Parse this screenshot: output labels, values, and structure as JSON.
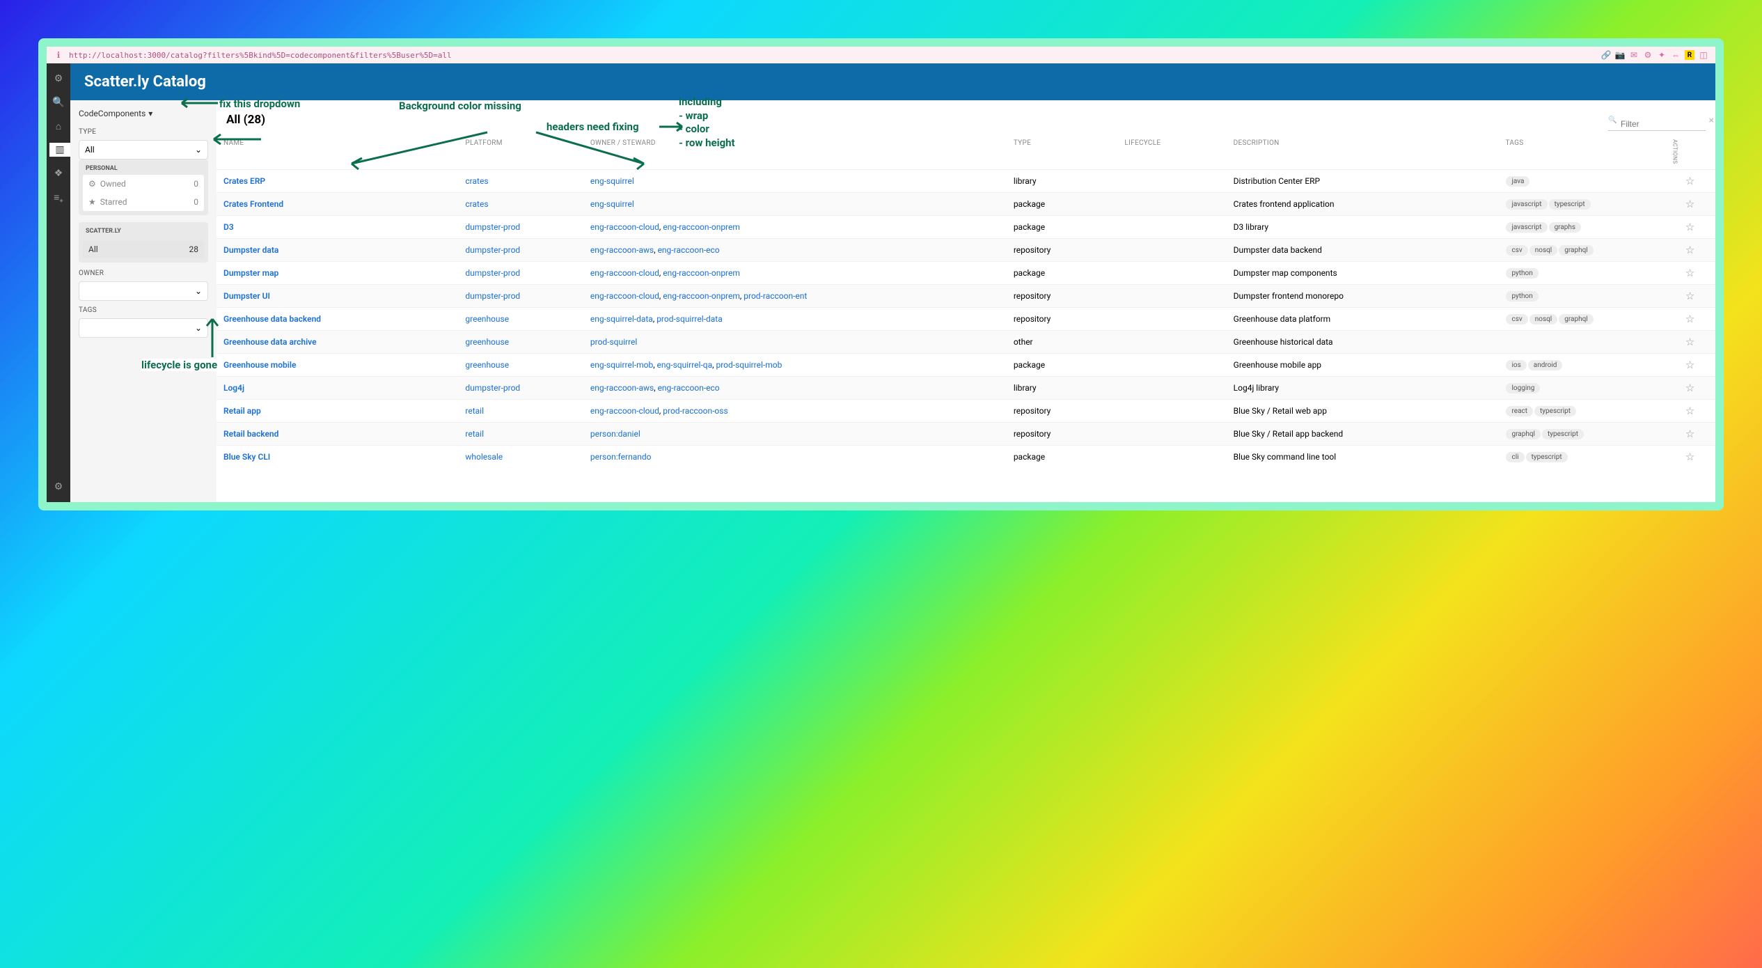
{
  "url": "http://localhost:3000/catalog?filters%5Bkind%5D=codecomponent&filters%5Buser%5D=all",
  "title": "Scatter.ly Catalog",
  "kind_dropdown": "CodeComponents",
  "table_title": "All (28)",
  "filter_placeholder": "Filter",
  "sidebar": {
    "type_label": "TYPE",
    "type_value": "All",
    "personal_label": "PERSONAL",
    "owned_label": "Owned",
    "owned_count": "0",
    "starred_label": "Starred",
    "starred_count": "0",
    "scatterly_label": "SCATTER.LY",
    "all_label": "All",
    "all_count": "28",
    "owner_label": "OWNER",
    "tags_label": "TAGS"
  },
  "columns": {
    "name": "NAME",
    "platform": "PLATFORM",
    "owner": "OWNER / STEWARD",
    "type": "TYPE",
    "lifecycle": "LIFECYCLE",
    "description": "DESCRIPTION",
    "tags": "TAGS",
    "actions": "ACTIONS"
  },
  "rows": [
    {
      "name": "Crates ERP",
      "platform": "crates",
      "owners": [
        "eng-squirrel"
      ],
      "type": "library",
      "lifecycle": "",
      "description": "Distribution Center ERP",
      "tags": [
        "java"
      ]
    },
    {
      "name": "Crates Frontend",
      "platform": "crates",
      "owners": [
        "eng-squirrel"
      ],
      "type": "package",
      "lifecycle": "",
      "description": "Crates frontend application",
      "tags": [
        "javascript",
        "typescript"
      ]
    },
    {
      "name": "D3",
      "platform": "dumpster-prod",
      "owners": [
        "eng-raccoon-cloud",
        "eng-raccoon-onprem"
      ],
      "type": "package",
      "lifecycle": "",
      "description": "D3 library",
      "tags": [
        "javascript",
        "graphs"
      ]
    },
    {
      "name": "Dumpster data",
      "platform": "dumpster-prod",
      "owners": [
        "eng-raccoon-aws",
        "eng-raccoon-eco"
      ],
      "type": "repository",
      "lifecycle": "",
      "description": "Dumpster data backend",
      "tags": [
        "csv",
        "nosql",
        "graphql"
      ]
    },
    {
      "name": "Dumpster map",
      "platform": "dumpster-prod",
      "owners": [
        "eng-raccoon-cloud",
        "eng-raccoon-onprem"
      ],
      "type": "package",
      "lifecycle": "",
      "description": "Dumpster map components",
      "tags": [
        "python"
      ]
    },
    {
      "name": "Dumpster UI",
      "platform": "dumpster-prod",
      "owners": [
        "eng-raccoon-cloud",
        "eng-raccoon-onprem",
        "prod-raccoon-ent"
      ],
      "type": "repository",
      "lifecycle": "",
      "description": "Dumpster frontend monorepo",
      "tags": [
        "python"
      ]
    },
    {
      "name": "Greenhouse data backend",
      "platform": "greenhouse",
      "owners": [
        "eng-squirrel-data",
        "prod-squirrel-data"
      ],
      "type": "repository",
      "lifecycle": "",
      "description": "Greenhouse data platform",
      "tags": [
        "csv",
        "nosql",
        "graphql"
      ]
    },
    {
      "name": "Greenhouse data archive",
      "platform": "greenhouse",
      "owners": [
        "prod-squirrel"
      ],
      "type": "other",
      "lifecycle": "",
      "description": "Greenhouse historical data",
      "tags": []
    },
    {
      "name": "Greenhouse mobile",
      "platform": "greenhouse",
      "owners": [
        "eng-squirrel-mob",
        "eng-squirrel-qa",
        "prod-squirrel-mob"
      ],
      "type": "package",
      "lifecycle": "",
      "description": "Greenhouse mobile app",
      "tags": [
        "ios",
        "android"
      ]
    },
    {
      "name": "Log4j",
      "platform": "dumpster-prod",
      "owners": [
        "eng-raccoon-aws",
        "eng-raccoon-eco"
      ],
      "type": "library",
      "lifecycle": "",
      "description": "Log4j library",
      "tags": [
        "logging"
      ]
    },
    {
      "name": "Retail app",
      "platform": "retail",
      "owners": [
        "eng-raccoon-cloud",
        "prod-raccoon-oss"
      ],
      "type": "repository",
      "lifecycle": "",
      "description": "Blue Sky / Retail web app",
      "tags": [
        "react",
        "typescript"
      ]
    },
    {
      "name": "Retail backend",
      "platform": "retail",
      "owners": [
        "person:daniel"
      ],
      "type": "repository",
      "lifecycle": "",
      "description": "Blue Sky / Retail app backend",
      "tags": [
        "graphql",
        "typescript"
      ]
    },
    {
      "name": "Blue Sky CLI",
      "platform": "wholesale",
      "owners": [
        "person:fernando"
      ],
      "type": "package",
      "lifecycle": "",
      "description": "Blue Sky command line tool",
      "tags": [
        "cli",
        "typescript"
      ]
    }
  ],
  "annotations": {
    "fix_dropdown": "fix this dropdown",
    "bg_missing": "Background color missing",
    "headers_fix": "headers need fixing",
    "including": "including\n- wrap\n- color\n- row height",
    "lifecycle_gone": "lifecycle is gone"
  }
}
